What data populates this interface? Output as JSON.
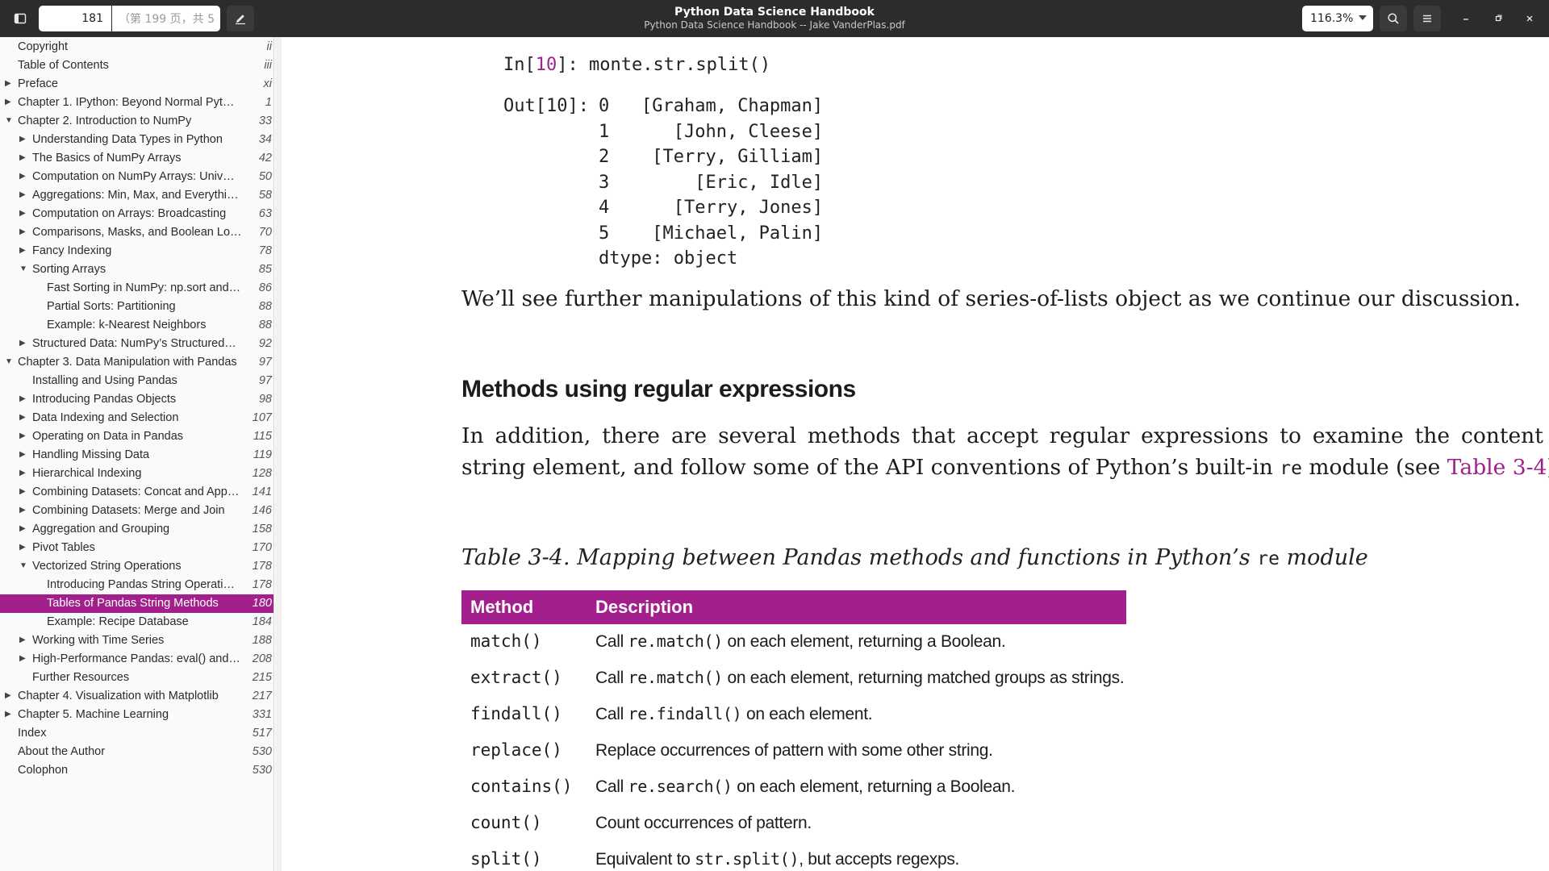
{
  "header": {
    "page_number": "181",
    "page_hint": "（第 199 页，共 5",
    "title": "Python Data Science Handbook",
    "subtitle": "Python Data Science Handbook -- Jake VanderPlas.pdf",
    "zoom": "116.3%",
    "icons": [
      "sidebar-toggle-icon",
      "annotate-pencil-icon",
      "search-icon",
      "hamburger-menu-icon",
      "minimize-icon",
      "restore-icon",
      "close-icon"
    ]
  },
  "toc": [
    {
      "label": "Copyright",
      "page": "ii",
      "level": 0,
      "arrow": "none"
    },
    {
      "label": "Table of Contents",
      "page": "iii",
      "level": 0,
      "arrow": "none"
    },
    {
      "label": "Preface",
      "page": "xi",
      "level": 0,
      "arrow": "right"
    },
    {
      "label": "Chapter 1. IPython: Beyond Normal Pyt…",
      "page": "1",
      "level": 0,
      "arrow": "right"
    },
    {
      "label": "Chapter 2. Introduction to NumPy",
      "page": "33",
      "level": 0,
      "arrow": "down"
    },
    {
      "label": "Understanding Data Types in Python",
      "page": "34",
      "level": 1,
      "arrow": "right"
    },
    {
      "label": "The Basics of NumPy Arrays",
      "page": "42",
      "level": 1,
      "arrow": "right"
    },
    {
      "label": "Computation on NumPy Arrays: Univ…",
      "page": "50",
      "level": 1,
      "arrow": "right"
    },
    {
      "label": "Aggregations: Min, Max, and Everythi…",
      "page": "58",
      "level": 1,
      "arrow": "right"
    },
    {
      "label": "Computation on Arrays: Broadcasting",
      "page": "63",
      "level": 1,
      "arrow": "right"
    },
    {
      "label": "Comparisons, Masks, and Boolean Lo…",
      "page": "70",
      "level": 1,
      "arrow": "right"
    },
    {
      "label": "Fancy Indexing",
      "page": "78",
      "level": 1,
      "arrow": "right"
    },
    {
      "label": "Sorting Arrays",
      "page": "85",
      "level": 1,
      "arrow": "down"
    },
    {
      "label": "Fast Sorting in NumPy: np.sort and…",
      "page": "86",
      "level": 2,
      "arrow": "none"
    },
    {
      "label": "Partial Sorts: Partitioning",
      "page": "88",
      "level": 2,
      "arrow": "none"
    },
    {
      "label": "Example: k-Nearest Neighbors",
      "page": "88",
      "level": 2,
      "arrow": "none"
    },
    {
      "label": "Structured Data: NumPy’s Structured…",
      "page": "92",
      "level": 1,
      "arrow": "right"
    },
    {
      "label": "Chapter 3. Data Manipulation with Pandas",
      "page": "97",
      "level": 0,
      "arrow": "down"
    },
    {
      "label": "Installing and Using Pandas",
      "page": "97",
      "level": 1,
      "arrow": "none"
    },
    {
      "label": "Introducing Pandas Objects",
      "page": "98",
      "level": 1,
      "arrow": "right"
    },
    {
      "label": "Data Indexing and Selection",
      "page": "107",
      "level": 1,
      "arrow": "right"
    },
    {
      "label": "Operating on Data in Pandas",
      "page": "115",
      "level": 1,
      "arrow": "right"
    },
    {
      "label": "Handling Missing Data",
      "page": "119",
      "level": 1,
      "arrow": "right"
    },
    {
      "label": "Hierarchical Indexing",
      "page": "128",
      "level": 1,
      "arrow": "right"
    },
    {
      "label": "Combining Datasets: Concat and App…",
      "page": "141",
      "level": 1,
      "arrow": "right"
    },
    {
      "label": "Combining Datasets: Merge and Join",
      "page": "146",
      "level": 1,
      "arrow": "right"
    },
    {
      "label": "Aggregation and Grouping",
      "page": "158",
      "level": 1,
      "arrow": "right"
    },
    {
      "label": "Pivot Tables",
      "page": "170",
      "level": 1,
      "arrow": "right"
    },
    {
      "label": "Vectorized String Operations",
      "page": "178",
      "level": 1,
      "arrow": "down"
    },
    {
      "label": "Introducing Pandas String Operati…",
      "page": "178",
      "level": 2,
      "arrow": "none"
    },
    {
      "label": "Tables of Pandas String Methods",
      "page": "180",
      "level": 2,
      "arrow": "none",
      "selected": true
    },
    {
      "label": "Example: Recipe Database",
      "page": "184",
      "level": 2,
      "arrow": "none"
    },
    {
      "label": "Working with Time Series",
      "page": "188",
      "level": 1,
      "arrow": "right"
    },
    {
      "label": "High-Performance Pandas: eval() and…",
      "page": "208",
      "level": 1,
      "arrow": "right"
    },
    {
      "label": "Further Resources",
      "page": "215",
      "level": 1,
      "arrow": "none"
    },
    {
      "label": "Chapter 4. Visualization with Matplotlib",
      "page": "217",
      "level": 0,
      "arrow": "right"
    },
    {
      "label": "Chapter 5. Machine Learning",
      "page": "331",
      "level": 0,
      "arrow": "right"
    },
    {
      "label": "Index",
      "page": "517",
      "level": 0,
      "arrow": "none"
    },
    {
      "label": "About the Author",
      "page": "530",
      "level": 0,
      "arrow": "none"
    },
    {
      "label": "Colophon",
      "page": "530",
      "level": 0,
      "arrow": "none"
    }
  ],
  "sidebar_tabs": [
    "thumbnails-icon",
    "outline-icon",
    "annotations-icon",
    "bookmarks-icon"
  ],
  "doc": {
    "code_in_prefix": "In[",
    "code_in_num": "10",
    "code_in_rest": "]: monte.str.split()",
    "code_out_label": "Out[10]:",
    "code_out_rows": [
      {
        "idx": "0",
        "val": "   [Graham, Chapman]"
      },
      {
        "idx": "1",
        "val": "      [John, Cleese]"
      },
      {
        "idx": "2",
        "val": "    [Terry, Gilliam]"
      },
      {
        "idx": "3",
        "val": "        [Eric, Idle]"
      },
      {
        "idx": "4",
        "val": "      [Terry, Jones]"
      },
      {
        "idx": "5",
        "val": "    [Michael, Palin]"
      }
    ],
    "code_dtype": "dtype: object",
    "para1": "We’ll see further manipulations of this kind of series-of-lists object as we continue our discussion.",
    "heading": "Methods using regular expressions",
    "para2_a": "In addition, there are several methods that accept regular expressions to examine the content of each string element, and follow some of the API conventions of Python’s built-in ",
    "para2_mono": "re",
    "para2_b": " module (see ",
    "para2_link": "Table 3-4",
    "para2_c": ").",
    "caption_a": "Table 3-4. Mapping between Pandas methods and functions in Python’s ",
    "caption_mono": "re",
    "caption_b": " module",
    "table_headers": [
      "Method",
      "Description"
    ],
    "table_rows": [
      {
        "method": "match()",
        "d1": "Call ",
        "dm": "re.match()",
        "d2": " on each element, returning a Boolean."
      },
      {
        "method": "extract()",
        "d1": "Call ",
        "dm": "re.match()",
        "d2": " on each element, returning matched groups as strings."
      },
      {
        "method": "findall()",
        "d1": "Call ",
        "dm": "re.findall()",
        "d2": " on each element."
      },
      {
        "method": "replace()",
        "d1": "Replace occurrences of pattern with some other string.",
        "dm": "",
        "d2": ""
      },
      {
        "method": "contains()",
        "d1": "Call ",
        "dm": "re.search()",
        "d2": " on each element, returning a Boolean."
      },
      {
        "method": "count()",
        "d1": "Count occurrences of pattern.",
        "dm": "",
        "d2": ""
      },
      {
        "method": "split()",
        "d1": "Equivalent to ",
        "dm": "str.split()",
        "d2": ", but accepts regexps."
      }
    ]
  },
  "colors": {
    "accent": "#a31f8c",
    "header_bg": "#2c2c2c",
    "sidebar_bg": "#fafafa"
  }
}
